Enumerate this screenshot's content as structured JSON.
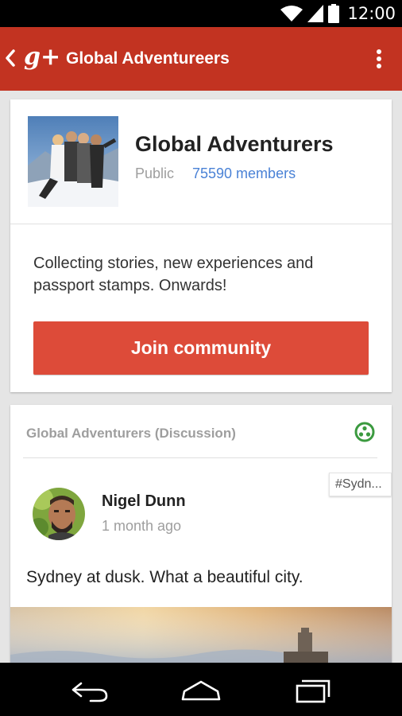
{
  "status_bar": {
    "time": "12:00",
    "icons": [
      "wifi-icon",
      "cell-signal-icon",
      "battery-icon"
    ]
  },
  "app_bar": {
    "logo": "g+",
    "title": "Global Adventureers",
    "back_icon": "chevron-left-icon",
    "menu_icon": "overflow-menu-icon"
  },
  "community": {
    "name": "Global Adventurers",
    "privacy": "Public",
    "members": "75590 members",
    "description": "Collecting stories, new experiences and passport stamps. Onwards!",
    "join_label": "Join community"
  },
  "post": {
    "category": "Global Adventurers (Discussion)",
    "category_icon": "discussion-icon",
    "hashtag": "#Sydn...",
    "author": "Nigel Dunn",
    "time": "1 month ago",
    "text": "Sydney at dusk. What a beautiful city."
  },
  "nav_bar": {
    "buttons": [
      "back-icon",
      "home-icon",
      "recents-icon"
    ]
  },
  "colors": {
    "app_bar": "#c23321",
    "join_button": "#dd4b39",
    "link": "#4a82d6",
    "discussion_icon": "#3b9a3f"
  }
}
